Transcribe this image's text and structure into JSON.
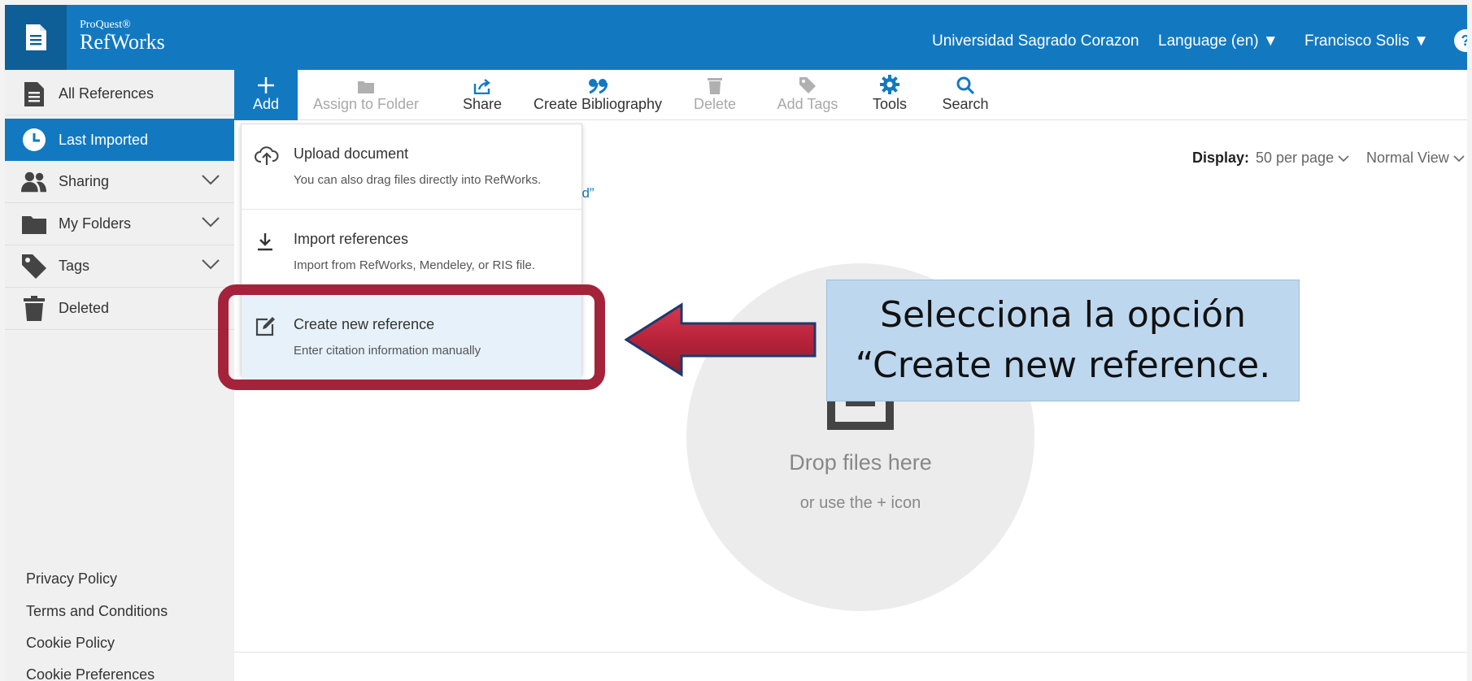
{
  "header": {
    "brand_small": "ProQuest®",
    "brand_big": "RefWorks",
    "institution": "Universidad Sagrado Corazon",
    "language": "Language (en) ▼",
    "user": "Francisco Solis ▼",
    "help": "?"
  },
  "sidebar": {
    "items": [
      {
        "label": "All References",
        "icon": "document-icon"
      },
      {
        "label": "Last Imported",
        "icon": "clock-icon"
      },
      {
        "label": "Sharing",
        "icon": "users-icon"
      },
      {
        "label": "My Folders",
        "icon": "folder-icon"
      },
      {
        "label": "Tags",
        "icon": "tag-icon"
      },
      {
        "label": "Deleted",
        "icon": "trash-icon"
      }
    ],
    "footer": [
      "Privacy Policy",
      "Terms and Conditions",
      "Cookie Policy",
      "Cookie Preferences"
    ]
  },
  "toolbar": {
    "add": "Add",
    "assign": "Assign to Folder",
    "share": "Share",
    "bibliography": "Create Bibliography",
    "delete": "Delete",
    "tags": "Add Tags",
    "tools": "Tools",
    "search": "Search"
  },
  "display": {
    "label": "Display:",
    "per_page": "50 per page",
    "view": "Normal View"
  },
  "partial_text": "ed”",
  "add_menu": [
    {
      "title": "Upload document",
      "desc": "You can also drag files directly into RefWorks."
    },
    {
      "title": "Import references",
      "desc": "Import from RefWorks, Mendeley, or RIS file."
    },
    {
      "title": "Create new reference",
      "desc": "Enter citation information manually"
    }
  ],
  "dropzone": {
    "title": "Drop files here",
    "subtitle": "or use the + icon"
  },
  "callout": {
    "line1": "Selecciona la opción",
    "line2": "“Create new reference."
  },
  "colors": {
    "brand_blue": "#1279c1",
    "highlight_red": "#a4233b",
    "callout_bg": "#bdd7ee"
  }
}
